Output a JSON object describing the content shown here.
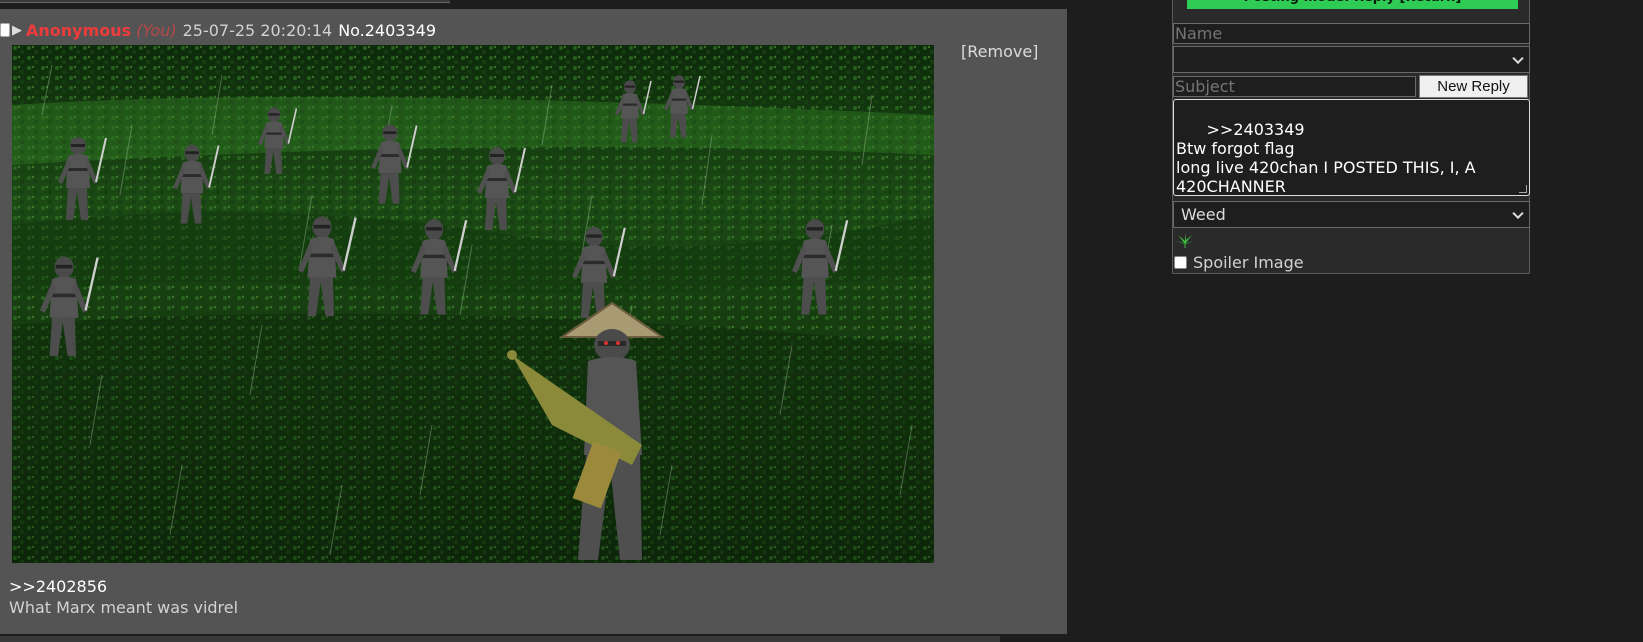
{
  "post": {
    "name": "Anonymous",
    "you_marker": "(You)",
    "datetime": "25-07-25 20:20:14",
    "number": "No.2403349",
    "remove_label": "[Remove]",
    "quote_link": ">>2402856",
    "text": "What Marx meant was vidrel"
  },
  "reply_form": {
    "posting_mode": "Posting mode: Reply [Return]",
    "name_placeholder": "Name",
    "email_value": "",
    "subject_placeholder": "Subject",
    "submit_label": "New Reply",
    "message": ">>2403349\nBtw forgot flag\nlong live 420chan I POSTED THIS, I, A\n420CHANNER",
    "flag_selected": "Weed",
    "spoiler_label": "Spoiler Image"
  },
  "colors": {
    "name": "#ef3b3b",
    "posting_mode_bg": "#2ecc55",
    "post_bg": "#545454",
    "page_bg": "#1d1d1d"
  }
}
